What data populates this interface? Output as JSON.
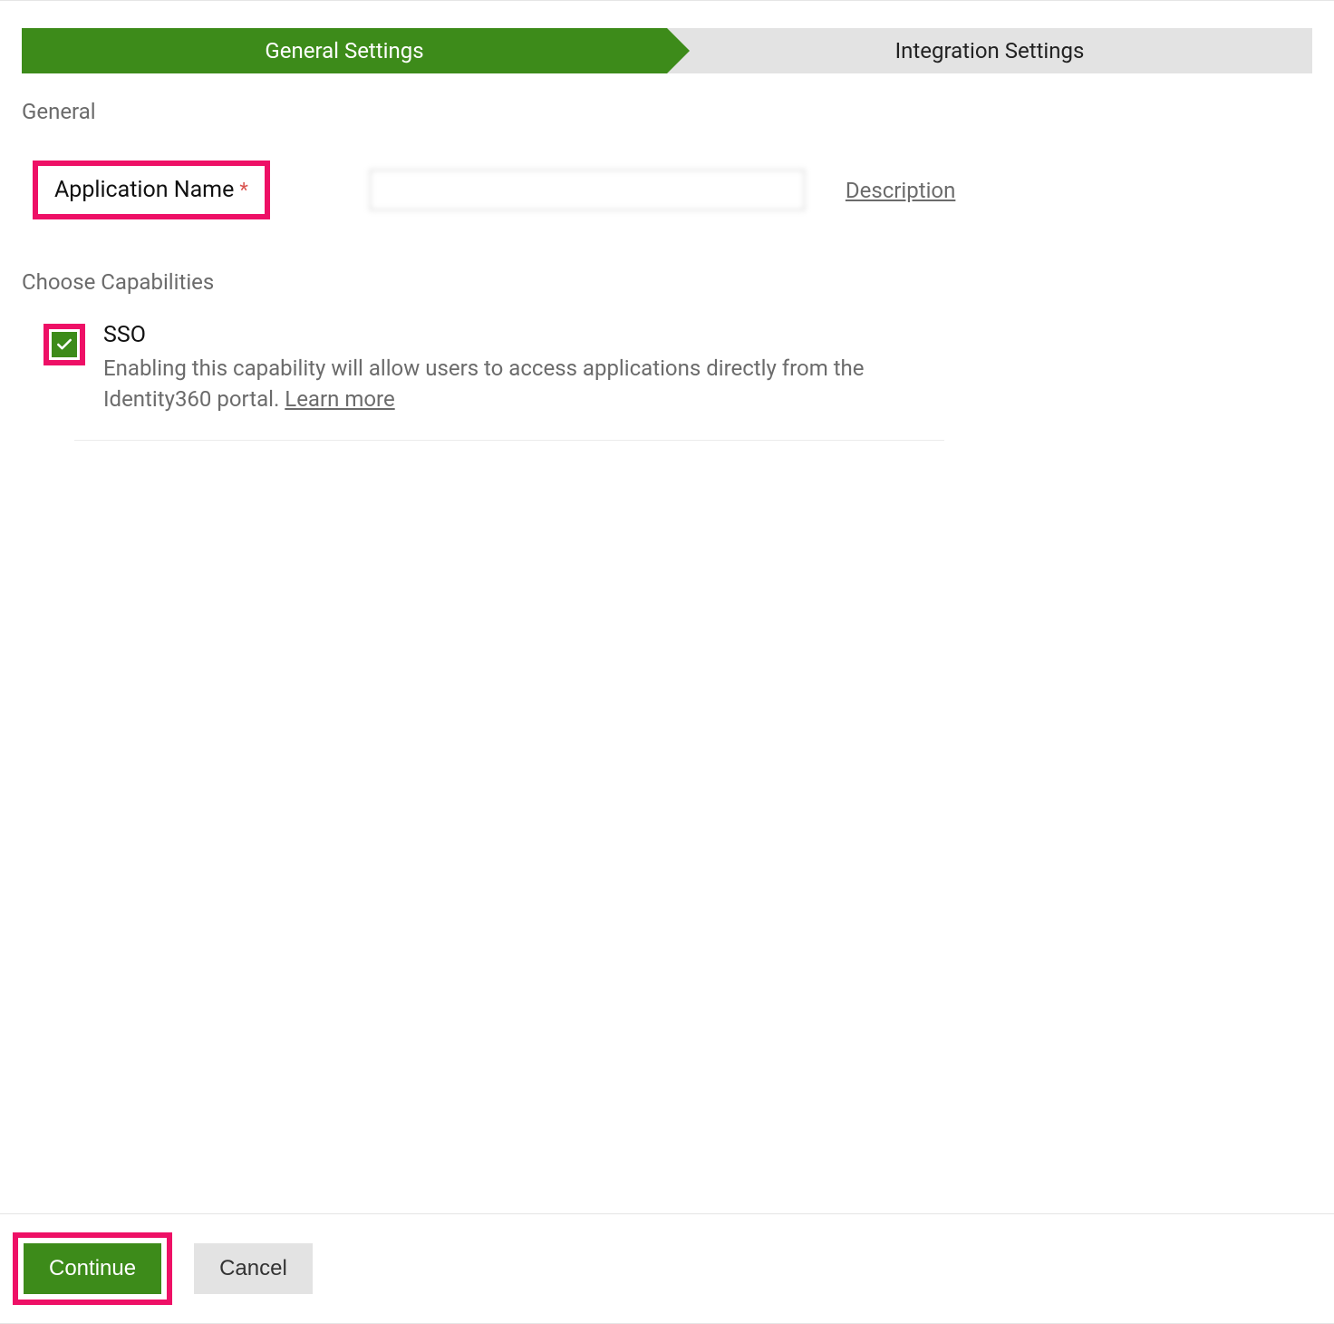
{
  "tabs": {
    "general": "General Settings",
    "integration": "Integration Settings"
  },
  "sections": {
    "general_heading": "General",
    "capabilities_heading": "Choose Capabilities"
  },
  "form": {
    "application_name_label": "Application Name",
    "required_mark": "*",
    "application_name_value": "",
    "description_link": "Description"
  },
  "capabilities": {
    "sso": {
      "title": "SSO",
      "description_part1": "Enabling this capability will allow users to access applications directly from the Identity360 portal. ",
      "learn_more": "Learn more",
      "checked": true
    }
  },
  "buttons": {
    "continue": "Continue",
    "cancel": "Cancel"
  },
  "colors": {
    "primary_green": "#3d8b1a",
    "highlight_pink": "#ee1066",
    "muted_text": "#6b6b6b",
    "border_gray": "#e5e5e5"
  }
}
